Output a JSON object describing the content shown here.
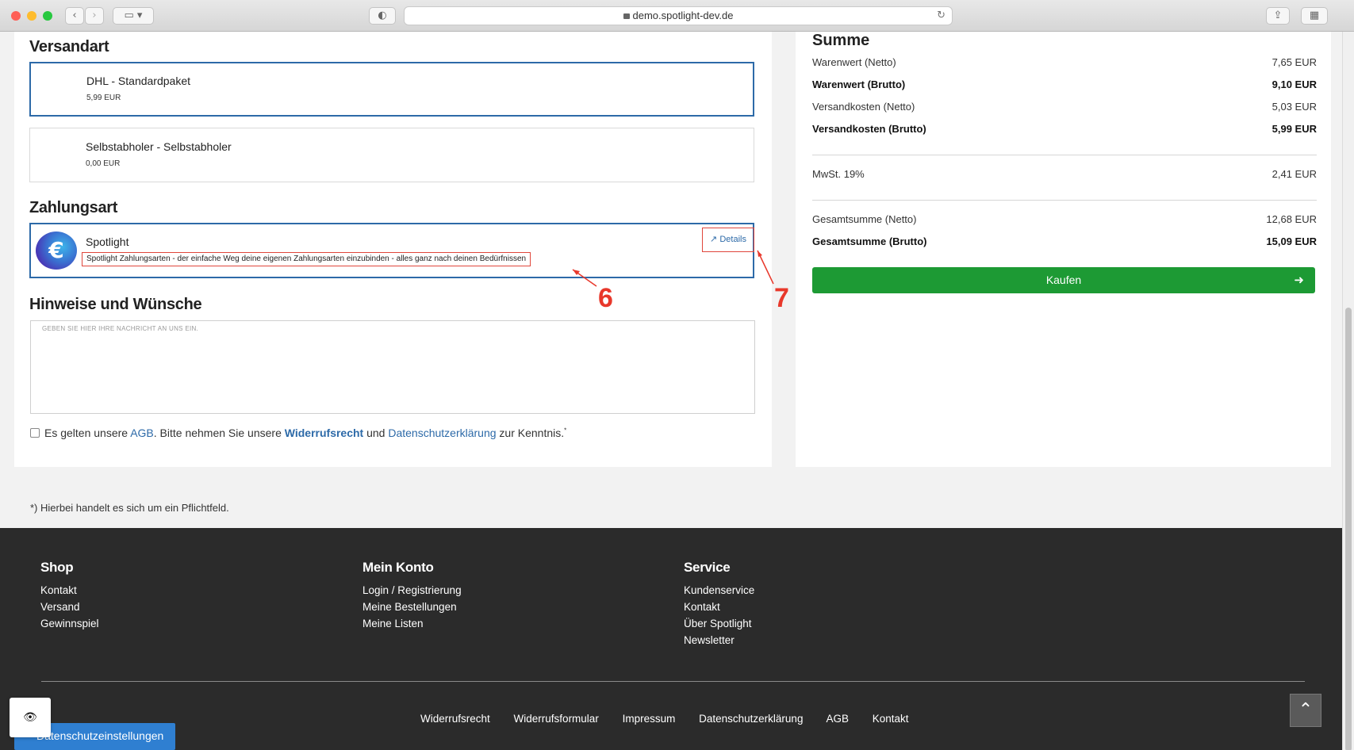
{
  "browser": {
    "url": "demo.spotlight-dev.de"
  },
  "versandart": {
    "heading": "Versandart",
    "options": [
      {
        "title": "DHL - Standardpaket",
        "price": "5,99 EUR",
        "selected": true
      },
      {
        "title": "Selbstabholer - Selbstabholer",
        "price": "0,00 EUR",
        "selected": false
      }
    ]
  },
  "zahlungsart": {
    "heading": "Zahlungsart",
    "method": {
      "title": "Spotlight",
      "description": "Spotlight Zahlungsarten - der einfache Weg deine eigenen Zahlungsarten einzubinden - alles ganz nach deinen Bedürfnissen",
      "details_label": "Details",
      "logo_glyph": "€"
    },
    "annotations": [
      "6",
      "7"
    ]
  },
  "hinweise": {
    "heading": "Hinweise und Wünsche",
    "placeholder": "Geben Sie hier Ihre Nachricht an uns ein."
  },
  "terms": {
    "part1": "Es gelten unsere ",
    "agb": "AGB",
    "part2": ". Bitte nehmen Sie unsere ",
    "widerruf": "Widerrufsrecht",
    "part3": " und ",
    "datenschutz": "Datenschutzerklärung",
    "part4": " zur Kenntnis.",
    "asterisk": "*"
  },
  "mandatory_note": "*) Hierbei handelt es sich um ein Pflichtfeld.",
  "summary": {
    "heading": "Summe",
    "rows": [
      {
        "label": "Warenwert (Netto)",
        "value": "7,65 EUR",
        "bold": false
      },
      {
        "label": "Warenwert (Brutto)",
        "value": "9,10 EUR",
        "bold": true
      },
      {
        "label": "Versandkosten (Netto)",
        "value": "5,03 EUR",
        "bold": false
      },
      {
        "label": "Versandkosten (Brutto)",
        "value": "5,99 EUR",
        "bold": true
      },
      {
        "label": "MwSt. 19%",
        "value": "2,41 EUR",
        "bold": false
      },
      {
        "label": "Gesamtsumme (Netto)",
        "value": "12,68 EUR",
        "bold": false
      },
      {
        "label": "Gesamtsumme (Brutto)",
        "value": "15,09 EUR",
        "bold": true
      }
    ],
    "buy_label": "Kaufen",
    "buy_color": "#1d9a34"
  },
  "footer": {
    "columns": [
      {
        "heading": "Shop",
        "links": [
          "Kontakt",
          "Versand",
          "Gewinnspiel"
        ]
      },
      {
        "heading": "Mein Konto",
        "links": [
          "Login / Registrierung",
          "Meine Bestellungen",
          "Meine Listen"
        ]
      },
      {
        "heading": "Service",
        "links": [
          "Kundenservice",
          "Kontakt",
          "Über Spotlight",
          "Newsletter"
        ]
      }
    ],
    "bottom_links": [
      "Widerrufsrecht",
      "Widerrufsformular",
      "Impressum",
      "Datenschutzerklärung",
      "AGB",
      "Kontakt"
    ]
  },
  "privacy_button": "Datenschutzeinstellungen",
  "colors": {
    "accent_blue": "#2d6aa8",
    "annotation_red": "#e8382b",
    "footer_bg": "#2b2b2b"
  }
}
